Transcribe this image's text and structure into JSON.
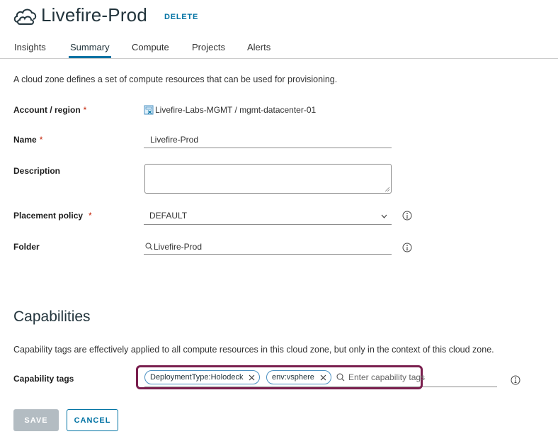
{
  "header": {
    "title": "Livefire-Prod",
    "delete_label": "DELETE",
    "icon": "cloud-zone-icon"
  },
  "tabs": [
    {
      "label": "Insights",
      "active": false
    },
    {
      "label": "Summary",
      "active": true
    },
    {
      "label": "Compute",
      "active": false
    },
    {
      "label": "Projects",
      "active": false
    },
    {
      "label": "Alerts",
      "active": false
    }
  ],
  "description": "A cloud zone defines a set of compute resources that can be used for provisioning.",
  "form": {
    "account_region": {
      "label": "Account / region",
      "required_mark": "*",
      "value": "Livefire-Labs-MGMT / mgmt-datacenter-01",
      "icon": "vsphere-account-icon"
    },
    "name": {
      "label": "Name",
      "required_mark": "*",
      "value": "Livefire-Prod"
    },
    "description": {
      "label": "Description",
      "value": ""
    },
    "placement_policy": {
      "label": "Placement policy",
      "required_mark": "*",
      "value": "DEFAULT"
    },
    "folder": {
      "label": "Folder",
      "value": "Livefire-Prod"
    }
  },
  "capabilities": {
    "heading": "Capabilities",
    "description": "Capability tags are effectively applied to all compute resources in this cloud zone, but only in the context of this cloud zone.",
    "tags_label": "Capability tags",
    "tags": [
      "DeploymentType:Holodeck",
      "env:vsphere"
    ],
    "placeholder": "Enter capability tags"
  },
  "actions": {
    "save_label": "SAVE",
    "cancel_label": "CANCEL"
  },
  "colors": {
    "accent": "#0072a3",
    "highlight": "#7a1f4e",
    "required": "#c21d00",
    "disabled_button": "#b3bcc2"
  }
}
